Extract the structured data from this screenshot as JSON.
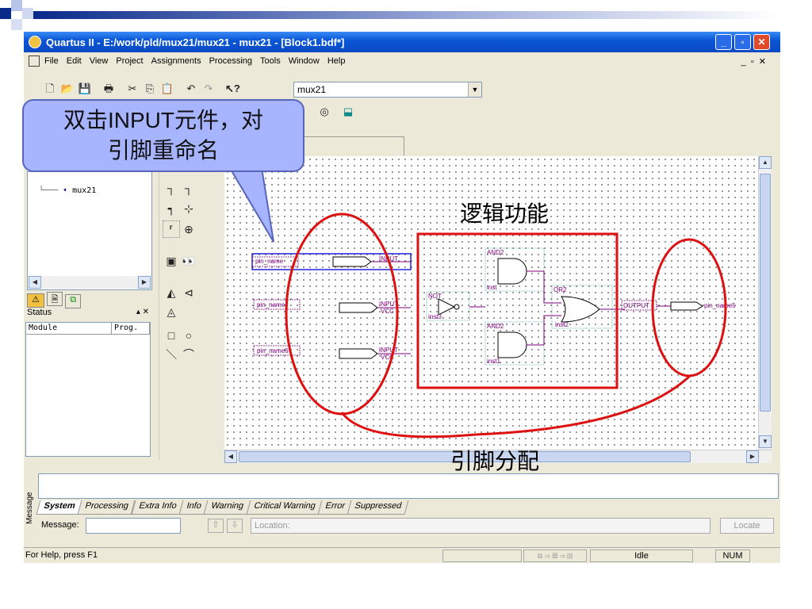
{
  "window": {
    "title": "Quartus II - E:/work/pld/mux21/mux21 - mux21 - [Block1.bdf*]"
  },
  "menu": [
    "File",
    "Edit",
    "View",
    "Project",
    "Assignments",
    "Processing",
    "Tools",
    "Window",
    "Help"
  ],
  "toolbar": {
    "combo_value": "mux21"
  },
  "doc_tab": {
    "label": "f*"
  },
  "tree": {
    "item": "mux21"
  },
  "status_panel": {
    "title": "Status",
    "col_module": "Module",
    "col_progress": "Prog."
  },
  "schematic": {
    "inputs": [
      {
        "name": "pin_name",
        "label": "INPUT",
        "vcc": "VCC"
      },
      {
        "name": "pin_name4",
        "label": "INPUT",
        "vcc": "VCC"
      },
      {
        "name": "pin_name6",
        "label": "INPUT",
        "vcc": "VCC"
      }
    ],
    "gates": [
      {
        "type": "NOT",
        "inst": "inst3"
      },
      {
        "type": "AND2",
        "inst": "inst"
      },
      {
        "type": "AND2",
        "inst": "inst1"
      },
      {
        "type": "OR2",
        "inst": "inst2"
      }
    ],
    "output": {
      "label": "OUTPUT",
      "name": "pin_name5"
    }
  },
  "messages": {
    "side_label": "Message",
    "tabs": [
      "System",
      "Processing",
      "Extra Info",
      "Info",
      "Warning",
      "Critical Warning",
      "Error",
      "Suppressed"
    ],
    "message_label": "Message:",
    "location_placeholder": "Location:",
    "locate_button": "Locate"
  },
  "statusbar": {
    "help": "For Help, press F1",
    "state": "Idle",
    "num": "NUM"
  },
  "annotations": {
    "callout": [
      "双击INPUT元件，对",
      "引脚重命名"
    ],
    "logic": "逻辑功能",
    "pins": "引脚分配"
  },
  "colors": {
    "title_blue": "#0b57d8",
    "annotation_red": "#dd1111",
    "callout_fill": "#a7b4ff",
    "wire_purple": "#800080"
  }
}
